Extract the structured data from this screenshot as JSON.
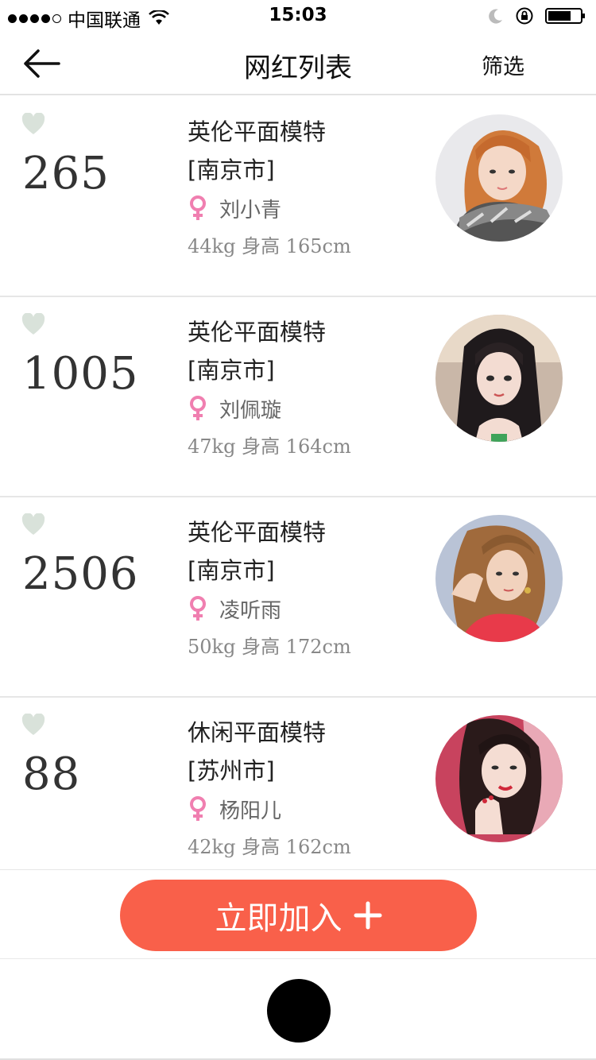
{
  "status_bar": {
    "carrier": "中国联通",
    "time": "15:03",
    "icons": [
      "signal-dots-icon",
      "wifi-icon",
      "moon-icon",
      "rotation-lock-icon",
      "battery-icon"
    ]
  },
  "nav": {
    "title": "网红列表",
    "filter_label": "筛选",
    "back_icon": "arrow-left-icon"
  },
  "items": [
    {
      "likes": "265",
      "category": "英伦平面模特",
      "city": "[南京市]",
      "name": "刘小青",
      "weight": "44kg",
      "height_label": "身高",
      "height": "165cm"
    },
    {
      "likes": "1005",
      "category": "英伦平面模特",
      "city": "[南京市]",
      "name": "刘佩璇",
      "weight": "47kg",
      "height_label": "身高",
      "height": "164cm"
    },
    {
      "likes": "2506",
      "category": "英伦平面模特",
      "city": "[南京市]",
      "name": "凌听雨",
      "weight": "50kg",
      "height_label": "身高",
      "height": "172cm"
    },
    {
      "likes": "88",
      "category": "休闲平面模特",
      "city": "[苏州市]",
      "name": "杨阳儿",
      "weight": "42kg",
      "height_label": "身高",
      "height": "162cm"
    }
  ],
  "join_button": {
    "label": "立即加入"
  },
  "colors": {
    "accent": "#f9604a",
    "heart": "#d9e2da",
    "female": "#f07fb0",
    "divider": "#e6e6e6"
  }
}
